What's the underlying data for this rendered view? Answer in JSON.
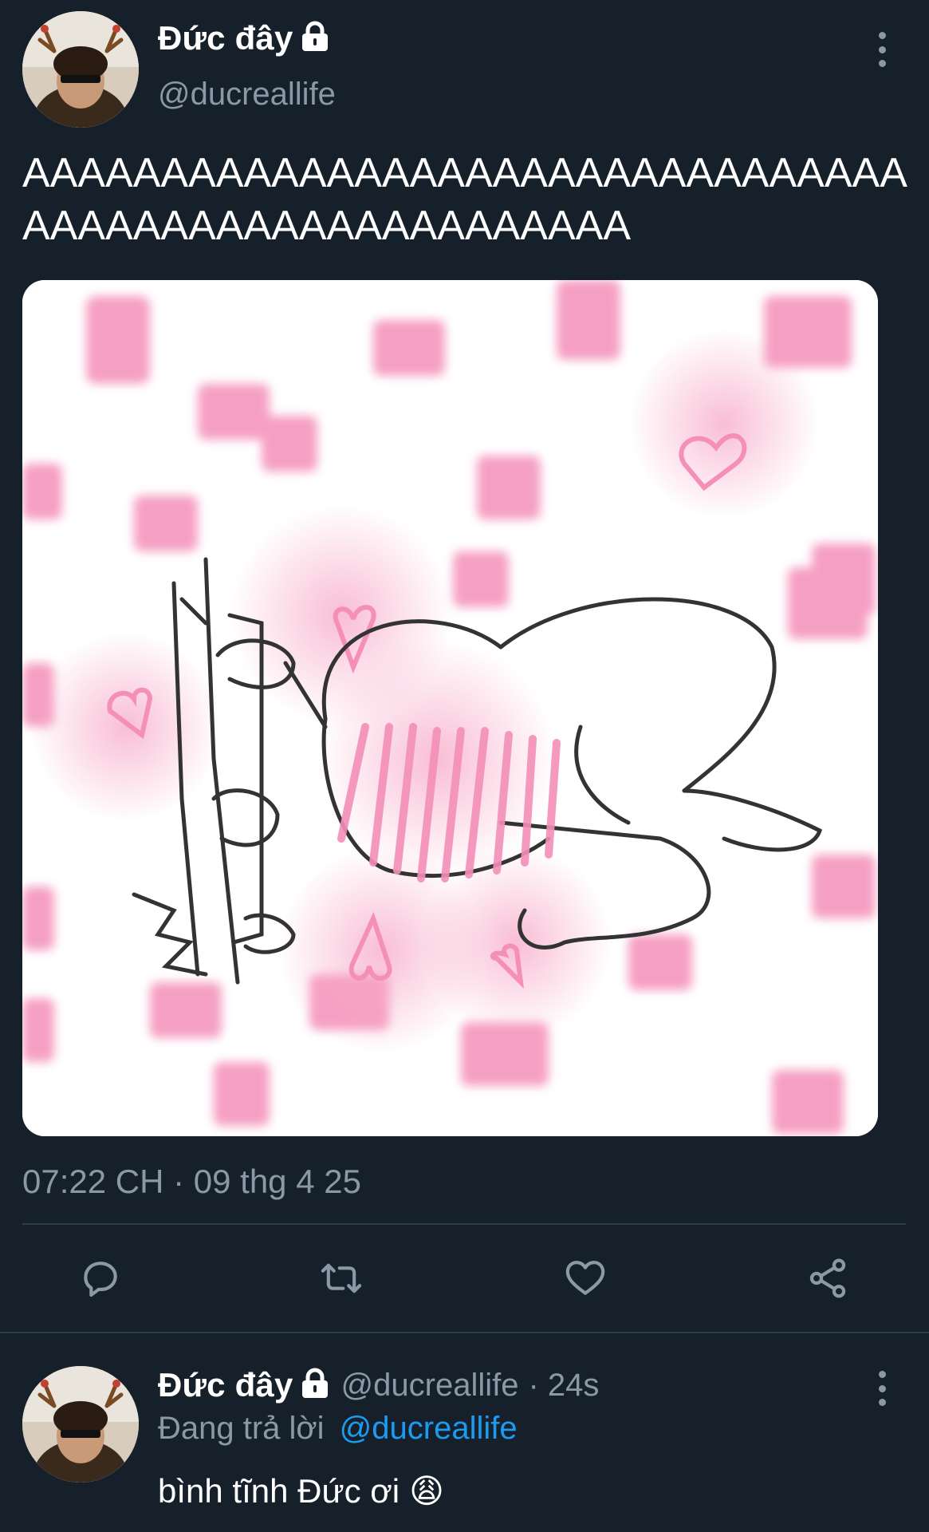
{
  "tweet": {
    "author_name": "Đức đây",
    "author_handle": "@ducreallife",
    "text": "AAAAAAAAAAAAAAAAAAAAAAAAAAAAAAAAAAAAAAAAAAAAAAAAAAAAAA",
    "timestamp": "07:22 CH · 09 thg 4 25",
    "media_icon": "heart-icon",
    "actions": [
      "reply-icon",
      "retweet-icon",
      "like-icon",
      "share-icon"
    ]
  },
  "reply": {
    "author_name": "Đức đây",
    "author_handle": "@ducreallife",
    "age": "· 24s",
    "replying_prefix": "Đang trả lời",
    "replying_to": "@ducreallife",
    "text": "bình tĩnh Đức ơi",
    "emoji": "😩"
  },
  "colors": {
    "background": "#15202b",
    "divider": "#2f3b47",
    "muted": "#8b98a5",
    "link": "#1d9bf0",
    "pink": "#f48fb8"
  }
}
